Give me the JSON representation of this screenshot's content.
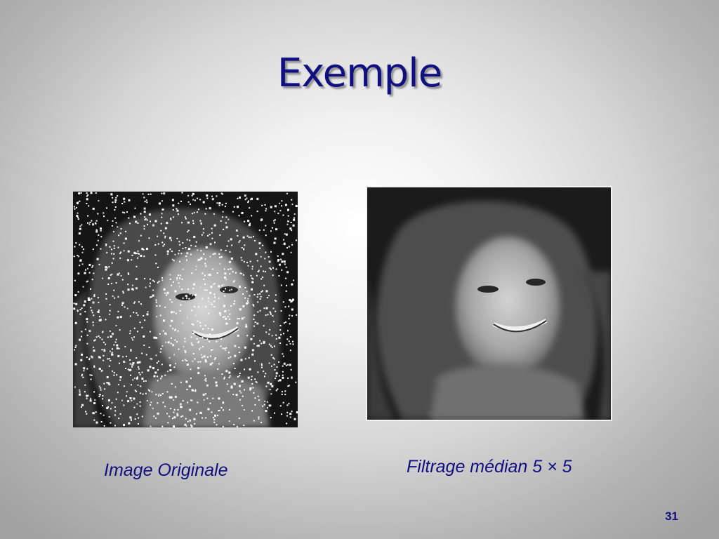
{
  "slide": {
    "title": "Exemple",
    "number": "31",
    "accent_color": "#101080"
  },
  "images": [
    {
      "caption": "Image Originale",
      "description_icon": "portrait-salt-and-pepper-noise"
    },
    {
      "caption": "Filtrage médian 5 × 5",
      "description_icon": "portrait-median-filtered"
    }
  ]
}
